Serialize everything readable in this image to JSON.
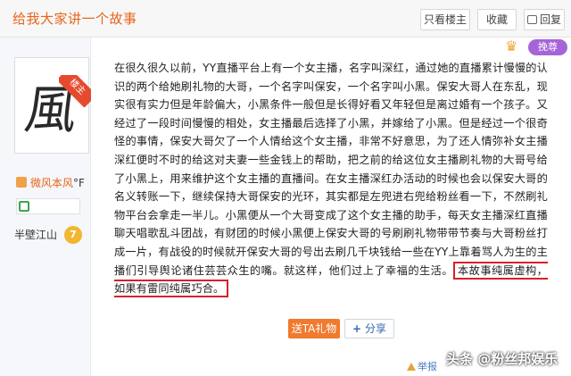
{
  "header": {
    "title": "给我大家讲一个故事",
    "only_author_label": "只看楼主",
    "favorite_label": "收藏",
    "reply_label": "回复"
  },
  "user": {
    "avatar_glyph": "風",
    "floor_badge": "楼主",
    "name": "微风本风",
    "name_suffix": "°F",
    "forum_name": "半壁江山",
    "forum_level": "7"
  },
  "vip": {
    "label": "挽尊"
  },
  "post": {
    "body": "在很久很久以前，YY直播平台上有一个女主播，名字叫深红，通过她的直播累计慢慢的认识的两个给她刷礼物的大哥，一个名字叫保安，一个名字叫小黑。保安大哥人在东乱，现实很有实力但是年龄偏大，小黑条件一般但是长得好看又年轻但是离过婚有一个孩子。又经过了一段时间慢慢的相处，女主播最后选择了小黑，并嫁给了小黑。但是经过一个很奇怪的事情，保安大哥欠了一个人情给这个女主播，非常不好意思，为了还人情弥补女主播深红便时不时的给这对夫妻一些金钱上的帮助，把之前的给这位女主播刷礼物的大哥号给了小黑上，用来维护这个女主播的直播间。在女主播深红办活动的时候也会以保安大哥的名义转账一下，继续保持大哥保安的光环，其实都是左兜进右兜给粉丝看一下，不然刷礼物平台会拿走一半儿。小黑便从一个大哥变成了这个女主播的助手，每天女主播深红直播聊天唱歌乱斗团战，有财团的时候小黑便上保安大哥的号刷刷礼物带带节奏与大哥粉丝打成一片，有战役的时候就开保安大哥的号出去刷几千块钱给一些在YY上靠着骂人为生的主播们引导舆论诸住芸芸众生的嘴。就这样，他们过上了幸福的生活。",
    "disclaimer": "本故事纯属虚构，如果有雷同纯属巧合。"
  },
  "actions": {
    "gift_label": "送TA礼物",
    "share_label": "分享"
  },
  "footer": {
    "report_label": "举报",
    "watermark": "头条 @粉丝邦娱乐"
  }
}
